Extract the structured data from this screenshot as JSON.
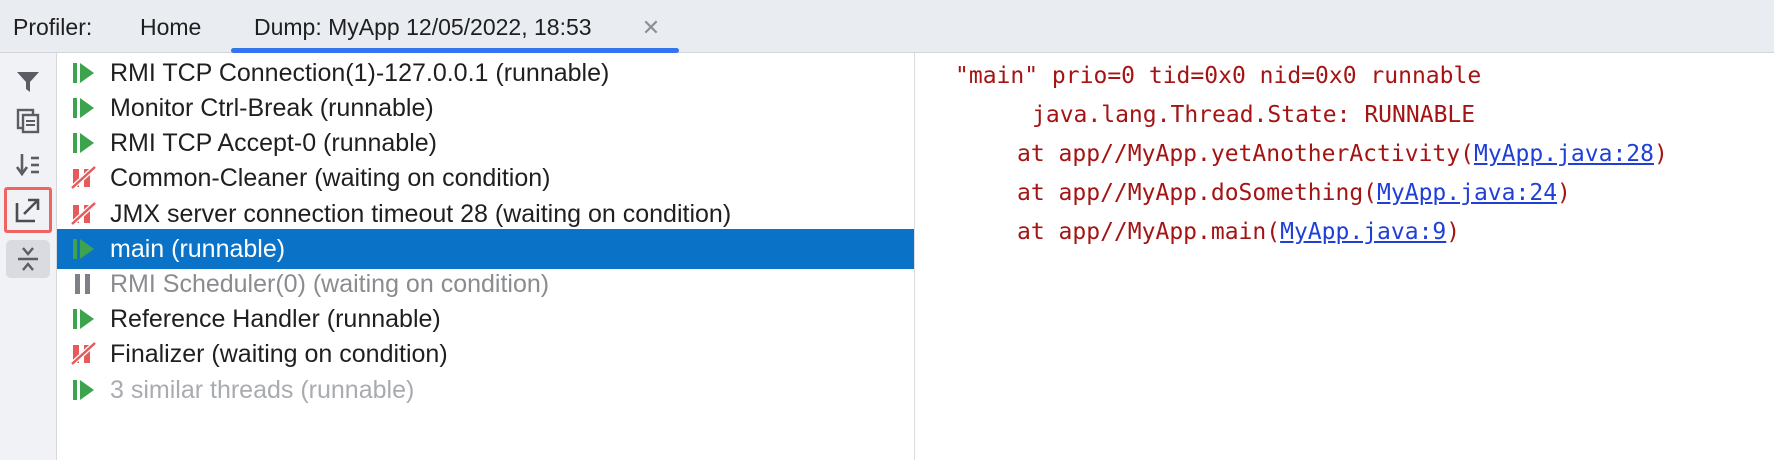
{
  "tabbar": {
    "label": "Profiler:",
    "tabs": [
      {
        "label": "Home"
      },
      {
        "label": "Dump: MyApp 12/05/2022, 18:53"
      }
    ]
  },
  "toolbar": [
    {
      "icon": "filter-icon"
    },
    {
      "icon": "copy-icon"
    },
    {
      "icon": "sort-icon"
    },
    {
      "icon": "export-icon"
    },
    {
      "icon": "collapse-icon"
    }
  ],
  "threads": [
    {
      "label": "RMI TCP Connection(1)-127.0.0.1 (runnable)",
      "state": "runnable"
    },
    {
      "label": "Monitor Ctrl-Break (runnable)",
      "state": "runnable"
    },
    {
      "label": "RMI TCP Accept-0 (runnable)",
      "state": "runnable"
    },
    {
      "label": "Common-Cleaner (waiting on condition)",
      "state": "waiting"
    },
    {
      "label": "JMX server connection timeout 28 (waiting on condition)",
      "state": "waiting"
    },
    {
      "label": "main (runnable)",
      "state": "runnable"
    },
    {
      "label": "RMI Scheduler(0) (waiting on condition)",
      "state": "paused"
    },
    {
      "label": "Reference Handler (runnable)",
      "state": "runnable"
    },
    {
      "label": "Finalizer (waiting on condition)",
      "state": "waiting"
    },
    {
      "label": "3 similar threads (runnable)",
      "state": "runnable"
    }
  ],
  "trace": {
    "header": "\"main\" prio=0 tid=0x0 nid=0x0 runnable",
    "state": "java.lang.Thread.State: RUNNABLE",
    "frames": [
      {
        "prefix": "at app//MyApp.yetAnotherActivity(",
        "link": "MyApp.java:28",
        "suffix": ")"
      },
      {
        "prefix": "at app//MyApp.doSomething(",
        "link": "MyApp.java:24",
        "suffix": ")"
      },
      {
        "prefix": "at app//MyApp.main(",
        "link": "MyApp.java:9",
        "suffix": ")"
      }
    ]
  },
  "colors": {
    "selection": "#0b73c7",
    "runnable_icon": "#3da34e",
    "waiting_icon": "#e55b5b",
    "trace_text": "#a41414",
    "trace_link": "#1f3fd6",
    "tab_underline": "#3574f0",
    "highlight_border": "#ef6363"
  }
}
